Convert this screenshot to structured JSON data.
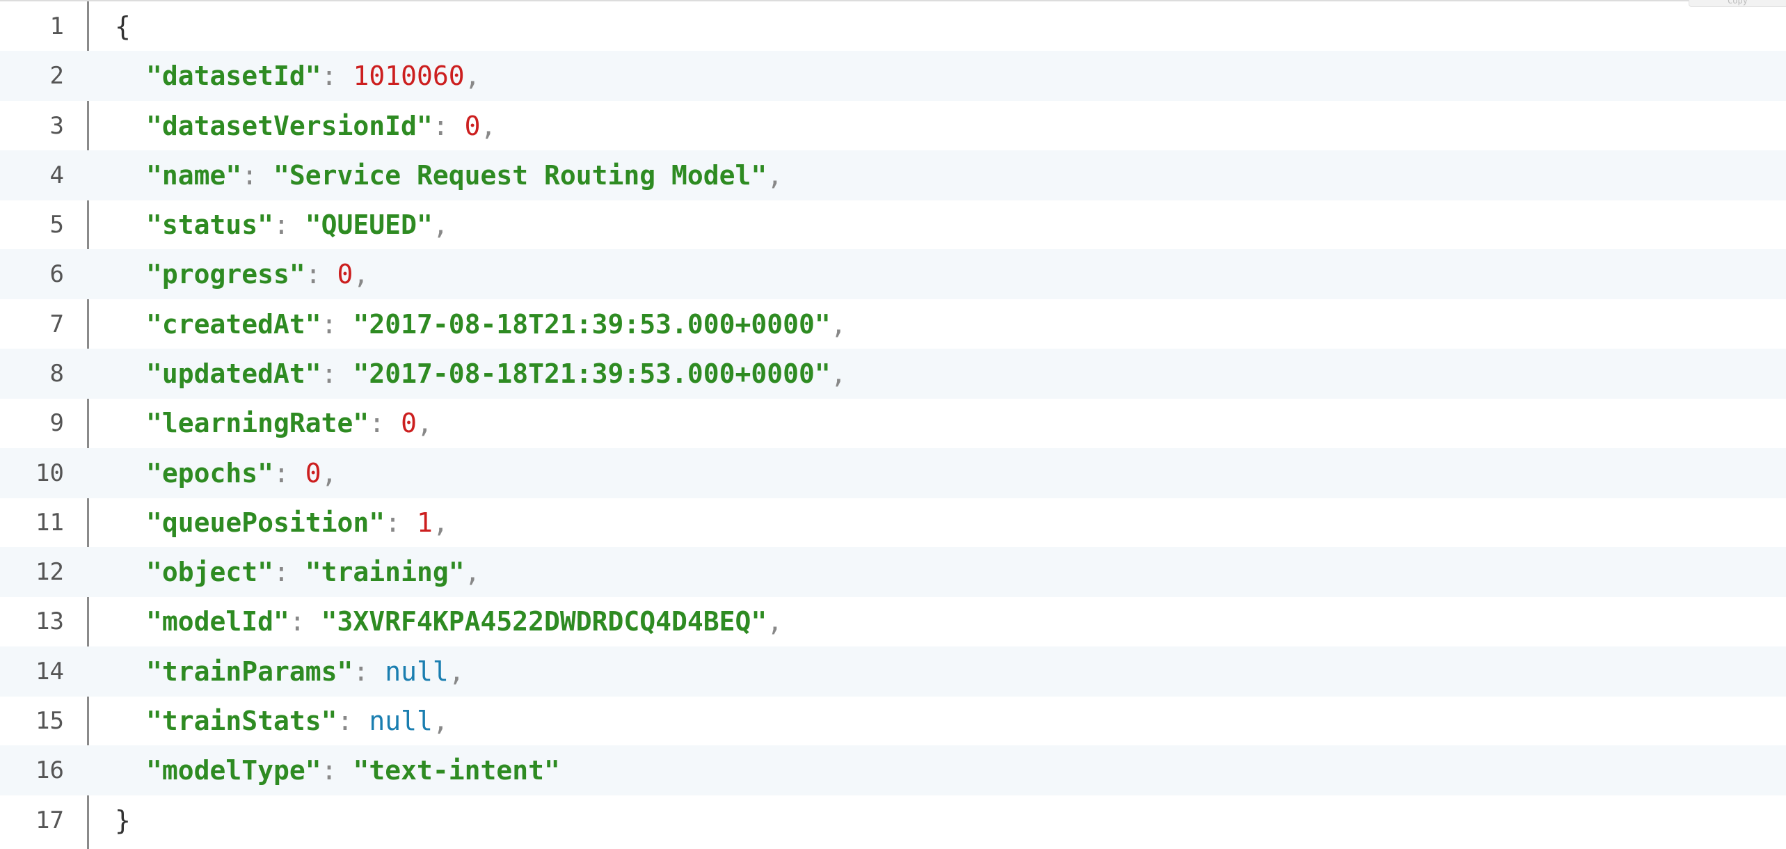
{
  "copy_button_label": "Copy",
  "code": {
    "open_brace": "{",
    "close_brace": "}",
    "lines": [
      {
        "n": "1"
      },
      {
        "n": "2",
        "key": "\"datasetId\"",
        "value": "1010060",
        "type": "num",
        "comma": ","
      },
      {
        "n": "3",
        "key": "\"datasetVersionId\"",
        "value": "0",
        "type": "num",
        "comma": ","
      },
      {
        "n": "4",
        "key": "\"name\"",
        "value": "\"Service Request Routing Model\"",
        "type": "str",
        "comma": ","
      },
      {
        "n": "5",
        "key": "\"status\"",
        "value": "\"QUEUED\"",
        "type": "str",
        "comma": ","
      },
      {
        "n": "6",
        "key": "\"progress\"",
        "value": "0",
        "type": "num",
        "comma": ","
      },
      {
        "n": "7",
        "key": "\"createdAt\"",
        "value": "\"2017-08-18T21:39:53.000+0000\"",
        "type": "str",
        "comma": ","
      },
      {
        "n": "8",
        "key": "\"updatedAt\"",
        "value": "\"2017-08-18T21:39:53.000+0000\"",
        "type": "str",
        "comma": ","
      },
      {
        "n": "9",
        "key": "\"learningRate\"",
        "value": "0",
        "type": "num",
        "comma": ","
      },
      {
        "n": "10",
        "key": "\"epochs\"",
        "value": "0",
        "type": "num",
        "comma": ","
      },
      {
        "n": "11",
        "key": "\"queuePosition\"",
        "value": "1",
        "type": "num",
        "comma": ","
      },
      {
        "n": "12",
        "key": "\"object\"",
        "value": "\"training\"",
        "type": "str",
        "comma": ","
      },
      {
        "n": "13",
        "key": "\"modelId\"",
        "value": "\"3XVRF4KPA4522DWDRDCQ4D4BEQ\"",
        "type": "str",
        "comma": ","
      },
      {
        "n": "14",
        "key": "\"trainParams\"",
        "value": "null",
        "type": "nul",
        "comma": ","
      },
      {
        "n": "15",
        "key": "\"trainStats\"",
        "value": "null",
        "type": "nul",
        "comma": ","
      },
      {
        "n": "16",
        "key": "\"modelType\"",
        "value": "\"text-intent\"",
        "type": "str",
        "comma": ""
      },
      {
        "n": "17"
      }
    ]
  },
  "colors": {
    "key": "#2e8b22",
    "string": "#2e8b22",
    "number": "#cc1f1f",
    "null": "#1a7eb0",
    "punctuation": "#888888",
    "alt_row_bg": "#f4f8fb"
  }
}
